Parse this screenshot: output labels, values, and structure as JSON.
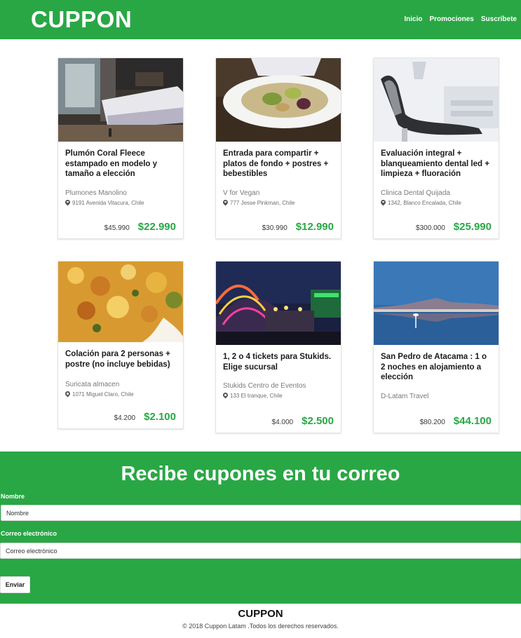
{
  "header": {
    "brand": "CUPPON",
    "nav": [
      "Inicio",
      "Promociones",
      "Suscríbete"
    ]
  },
  "cards": [
    {
      "title": "Plumón Coral Fleece estampado en modelo y tamaño a elección",
      "merchant": "Plumones Manolino",
      "address": "9191 Avenida Vitacura, Chile",
      "old_price": "$45.990",
      "new_price": "$22.990",
      "image": "bedroom"
    },
    {
      "title": "Entrada para compartir + platos de fondo + postres + bebestibles",
      "merchant": "V for Vegan",
      "address": "777 Jesse Pinkman, Chile",
      "old_price": "$30.990",
      "new_price": "$12.990",
      "image": "salad-plate"
    },
    {
      "title": "Evaluación integral + blanqueamiento dental led + limpieza + fluoración",
      "merchant": "Clinica Dental Quijada",
      "address": "1342, Blanco Encalada, Chile",
      "old_price": "$300.000",
      "new_price": "$25.990",
      "image": "dental-chair"
    },
    {
      "title": "Colación para 2 personas + postre (no incluye bebidas)",
      "merchant": "Suricata almacen",
      "address": "1071 Miguel Claro, Chile",
      "old_price": "$4.200",
      "new_price": "$2.100",
      "image": "stew"
    },
    {
      "title": "1, 2 o 4 tickets para Stukids. Elige sucursal",
      "merchant": "Stukids Centro de Eventos",
      "address": "133 El tranque, Chile",
      "old_price": "$4.000",
      "new_price": "$2.500",
      "image": "fair-lights"
    },
    {
      "title": "San Pedro de Atacama : 1 o 2 noches en alojamiento a elección",
      "merchant": "D-Latam Travel",
      "address": "",
      "old_price": "$80.200",
      "new_price": "$44.100",
      "image": "salt-lake"
    }
  ],
  "subscribe": {
    "title": "Recibe cupones en tu correo",
    "name_label": "Nombre",
    "name_placeholder": "Nombre",
    "email_label": "Correo electrónico",
    "email_placeholder": "Correo electrónico",
    "submit_label": "Enviar"
  },
  "footer": {
    "brand": "CUPPON",
    "copyright": "© 2018 Cuppon Latam .Todos los derechos reservados."
  },
  "colors": {
    "brand_green": "#29a745",
    "price_green": "#29a745"
  }
}
